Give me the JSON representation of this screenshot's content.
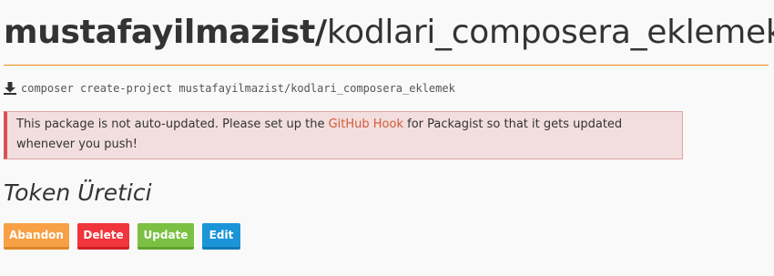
{
  "package": {
    "vendor": "mustafayilmazist/",
    "name": "kodlari_composera_eklemek"
  },
  "install": {
    "icon": "download-icon",
    "command": "composer create-project mustafayilmazist/kodlari_composera_eklemek"
  },
  "alert": {
    "text_before": "This package is not auto-updated. Please set up the ",
    "link_text": "GitHub Hook",
    "text_after": " for Packagist so that it gets updated whenever you push!"
  },
  "section": {
    "title": "Token Üretici"
  },
  "actions": {
    "abandon": "Abandon",
    "delete": "Delete",
    "update": "Update",
    "edit": "Edit"
  },
  "colors": {
    "accent_rule": "#f28d1a",
    "alert_bg": "#f2dede",
    "alert_border": "#d9534f",
    "link": "#d15b3a",
    "abandon": "#f7a046",
    "delete": "#f0353c",
    "update": "#7bc043",
    "edit": "#1b95d8"
  }
}
